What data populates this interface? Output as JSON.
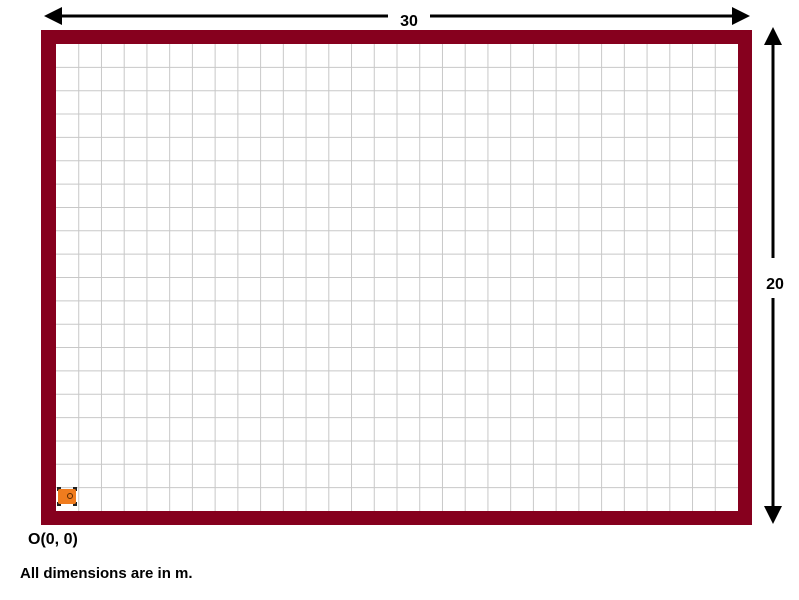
{
  "arena": {
    "width_label": "30",
    "height_label": "20",
    "width_m": 30,
    "height_m": 20,
    "grid_cols": 30,
    "grid_rows": 20,
    "wall_color": "#86001e",
    "grid_color": "#c8c8c8"
  },
  "robot": {
    "icon": "robot-car-icon",
    "color": "#f07c1e",
    "position_m": [
      0,
      0
    ]
  },
  "origin_label": "O(0, 0)",
  "units_note": "All dimensions are in m."
}
